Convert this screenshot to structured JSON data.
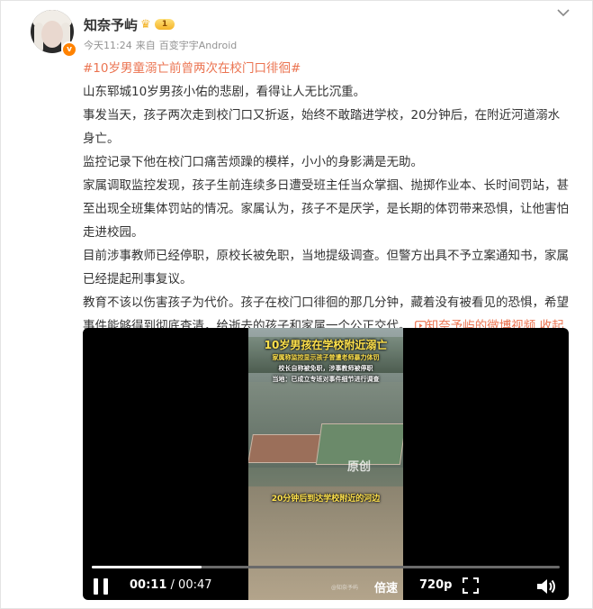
{
  "post": {
    "username": "知奈予屿",
    "level_label": "1",
    "verified_mark": "v",
    "time": "今天11:24",
    "source_prefix": "来自",
    "source": "百变宇宇Android",
    "hashtag": "#10岁男童溺亡前曾两次在校门口徘徊#",
    "paragraphs": [
      "山东郓城10岁男孩小佑的悲剧，看得让人无比沉重。",
      "事发当天，孩子两次走到校门口又折返，始终不敢踏进学校，20分钟后，在附近河道溺水身亡。",
      "监控记录下他在校门口痛苦烦躁的模样，小小的身影满是无助。",
      "家属调取监控发现，孩子生前连续多日遭受班主任当众掌掴、抛掷作业本、长时间罚站，甚至出现全班集体罚站的情况。家属认为，孩子不是厌学，是长期的体罚带来恐惧，让他害怕走进校园。",
      "目前涉事教师已经停职，原校长被免职，当地提级调查。但警方出具不予立案通知书，家属已经提起刑事复议。",
      "教育不该以伤害孩子为代价。孩子在校门口徘徊的那几分钟，藏着没有被看见的恐惧，希望事件能够得到彻底查清，给逝去的孩子和家属一个公正交代。"
    ],
    "video_link": "知奈予屿的微博视频",
    "collapse": "收起"
  },
  "video": {
    "overlay_title": "10岁男孩在学校附近溺亡",
    "overlay_line1": "家属称监控显示孩子曾遭老师暴力体罚",
    "overlay_line2": "校长自称被免职，涉事教师被停职",
    "overlay_line3": "当地：已成立专班对事件细节进行调查",
    "overlay_bottom": "20分钟后到达学校附近的河边",
    "watermark": "原创",
    "watermark_small": "@知奈予屿",
    "current_time": "00:11",
    "separator": " / ",
    "duration": "00:47",
    "progress": 0.234,
    "speed_label": "倍速",
    "quality_label": "720p"
  },
  "icons": {
    "more": "chevron-down-icon",
    "pause": "pause-icon",
    "fullscreen": "fullscreen-icon",
    "volume": "volume-icon",
    "link": "video-link-icon",
    "collapse": "chevron-up-icon"
  },
  "colors": {
    "accent": "#eb7350",
    "text": "#333333",
    "meta": "#939393"
  }
}
